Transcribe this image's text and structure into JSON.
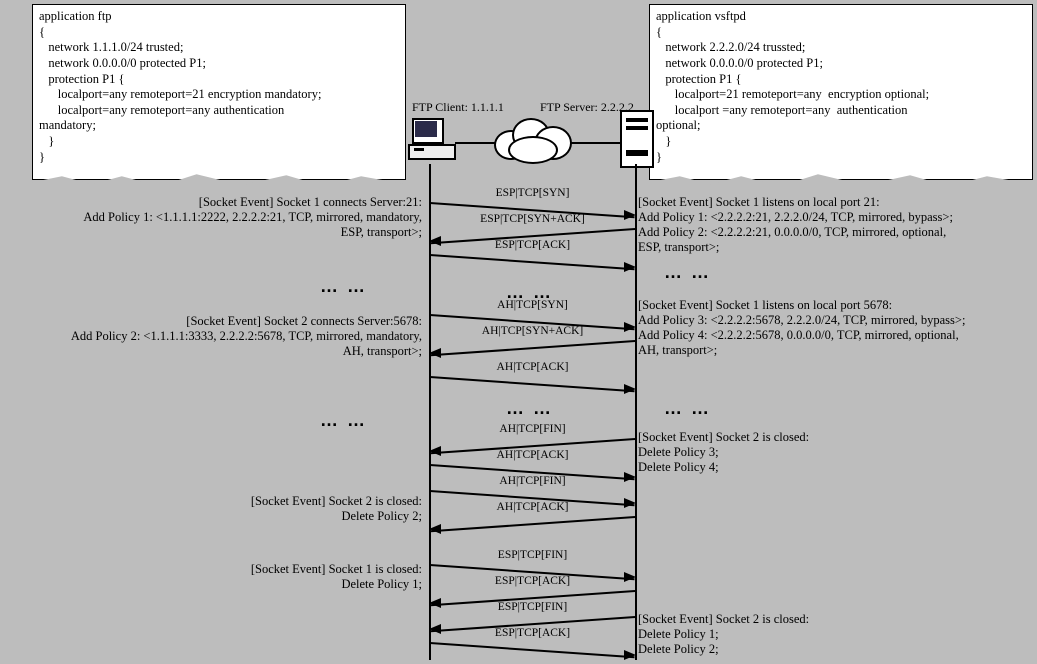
{
  "leftCode": "application ftp\n{\n   network 1.1.1.0/24 trusted;\n   network 0.0.0.0/0 protected P1;\n   protection P1 {\n      localport=any remoteport=21 encryption mandatory;\n      localport=any remoteport=any authentication\nmandatory;\n   }\n}",
  "rightCode": "application vsftpd\n{\n   network 2.2.2.0/24 trussted;\n   network 0.0.0.0/0 protected P1;\n   protection P1 {\n      localport=21 remoteport=any  encryption optional;\n      localport =any remoteport=any  authentication\noptional;\n   }\n}",
  "clientLabel": "FTP Client: 1.1.1.1",
  "serverLabel": "FTP Server: 2.2.2.2",
  "dots": "… …",
  "messages": {
    "m1": "ESP|TCP[SYN]",
    "m2": "ESP|TCP[SYN+ACK]",
    "m3": "ESP|TCP[ACK]",
    "m4": "AH|TCP[SYN]",
    "m5": "AH|TCP[SYN+ACK]",
    "m6": "AH|TCP[ACK]",
    "m7": "AH|TCP[FIN]",
    "m8": "AH|TCP[ACK]",
    "m9": "AH|TCP[FIN]",
    "m10": "AH|TCP[ACK]",
    "m11": "ESP|TCP[FIN]",
    "m12": "ESP|TCP[ACK]",
    "m13": "ESP|TCP[FIN]",
    "m14": "ESP|TCP[ACK]"
  },
  "eventsLeft": {
    "e1": "[Socket Event] Socket 1 connects Server:21:\nAdd Policy 1: <1.1.1.1:2222, 2.2.2.2:21, TCP, mirrored, mandatory,\nESP, transport>;",
    "e2": "[Socket Event] Socket 2 connects Server:5678:\nAdd Policy 2: <1.1.1.1:3333, 2.2.2.2:5678, TCP, mirrored, mandatory,\nAH, transport>;",
    "e3": "[Socket Event] Socket 2 is closed:\nDelete Policy 2;",
    "e4": "[Socket Event] Socket 1 is closed:\nDelete Policy 1;"
  },
  "eventsRight": {
    "e1": "[Socket Event] Socket 1 listens on local  port 21:\nAdd Policy 1: <2.2.2.2:21, 2.2.2.0/24, TCP, mirrored, bypass>;\nAdd Policy 2: <2.2.2.2:21, 0.0.0.0/0, TCP, mirrored, optional,\nESP, transport>;",
    "e2": "[Socket Event] Socket 1 listens on local  port 5678:\nAdd Policy 3: <2.2.2.2:5678, 2.2.2.0/24, TCP, mirrored, bypass>;\nAdd Policy 4: <2.2.2.2:5678, 0.0.0.0/0, TCP, mirrored, optional,\nAH, transport>;",
    "e3": "[Socket Event] Socket 2 is closed:\nDelete Policy 3;\nDelete Policy 4;",
    "e4": "[Socket Event] Socket 2 is closed:\nDelete Policy 1;\nDelete Policy 2;"
  }
}
